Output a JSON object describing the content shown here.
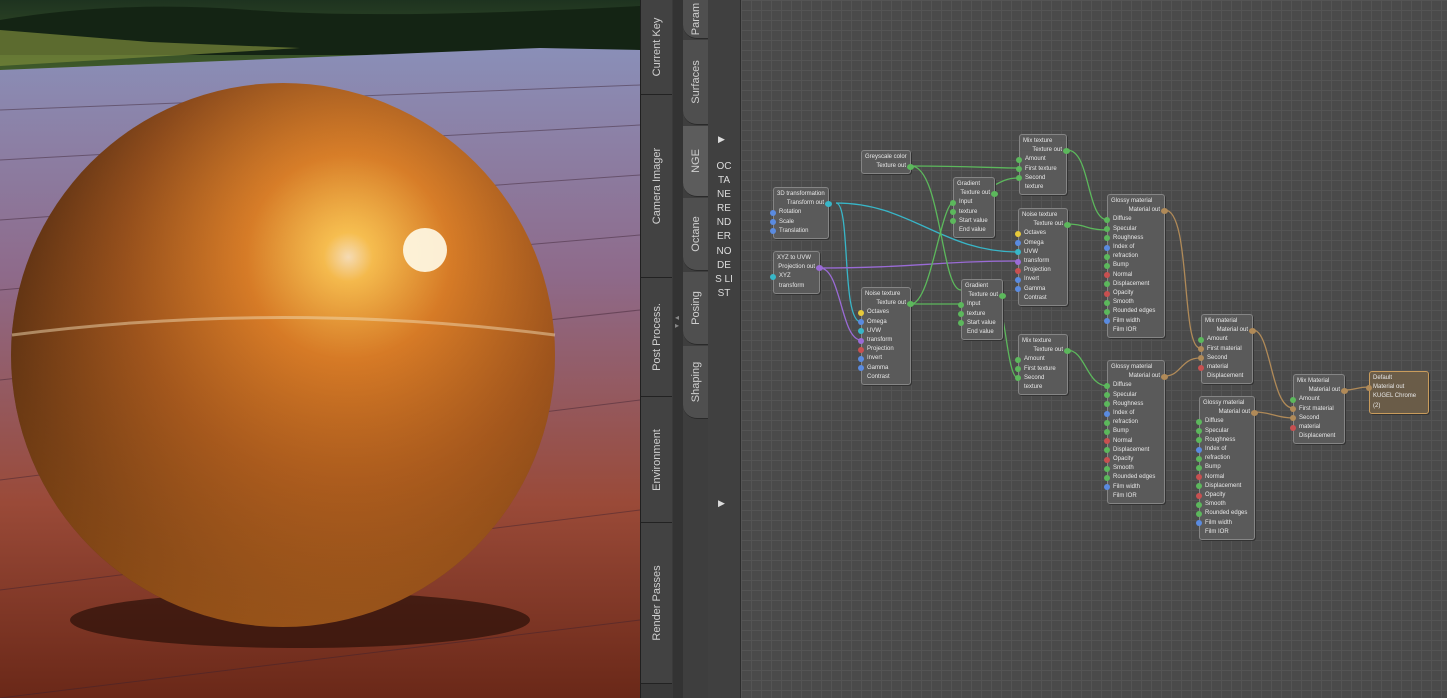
{
  "left_tabs": [
    "Current Key",
    "Camera Imager",
    "Post Process.",
    "Environment",
    "Render Passes"
  ],
  "right_tabs": [
    "Param",
    "Surfaces",
    "NGE",
    "Octane",
    "Posing",
    "Shaping"
  ],
  "nodes_list": {
    "title": "OCTANE RENDER NODES LIST"
  },
  "colors": {
    "texture": "#5cb85c",
    "material": "#b08a58",
    "transform": "#38b6c8",
    "projection": "#9a6bd6",
    "float": "#5a8be0",
    "int": "#e7c93a",
    "bool": "#c85050"
  },
  "nodes": {
    "greyscale": {
      "title": "Greyscale color",
      "out": "Texture out"
    },
    "trans3d": {
      "title": "3D transformation",
      "out": "Transform out",
      "inputs": [
        "Rotation",
        "Scale",
        "Translation"
      ]
    },
    "xyz2uvw": {
      "title": "XYZ to UVW",
      "out": "Projection out",
      "inputs": [
        "XYZ transform"
      ]
    },
    "noise1": {
      "title": "Noise texture",
      "out": "Texture out",
      "inputs": [
        "Octaves",
        "Omega",
        "UVW transform",
        "Projection",
        "Invert",
        "Gamma",
        "Contrast"
      ]
    },
    "gradient1": {
      "title": "Gradient",
      "out": "Texture out",
      "inputs": [
        "Input texture",
        "Start value",
        "End value"
      ]
    },
    "gradient2": {
      "title": "Gradient",
      "out": "Texture out",
      "inputs": [
        "Input texture",
        "Start value",
        "End value"
      ]
    },
    "mix1": {
      "title": "Mix texture",
      "out": "Texture out",
      "inputs": [
        "Amount",
        "First texture",
        "Second texture"
      ]
    },
    "noise2": {
      "title": "Noise texture",
      "out": "Texture out",
      "inputs": [
        "Octaves",
        "Omega",
        "UVW transform",
        "Projection",
        "Invert",
        "Gamma",
        "Contrast"
      ]
    },
    "mix2": {
      "title": "Mix texture",
      "out": "Texture out",
      "inputs": [
        "Amount",
        "First texture",
        "Second texture"
      ]
    },
    "glossy1": {
      "title": "Glossy material",
      "out": "Material out",
      "inputs": [
        "Diffuse",
        "Specular",
        "Roughness",
        "Index of refraction",
        "Bump",
        "Normal",
        "Displacement",
        "Opacity",
        "Smooth",
        "Rounded edges",
        "Film width",
        "Film IOR"
      ]
    },
    "glossy2": {
      "title": "Glossy material",
      "out": "Material out",
      "inputs": [
        "Diffuse",
        "Specular",
        "Roughness",
        "Index of refraction",
        "Bump",
        "Normal",
        "Displacement",
        "Opacity",
        "Smooth",
        "Rounded edges",
        "Film width",
        "Film IOR"
      ]
    },
    "glossy3": {
      "title": "Glossy material",
      "out": "Material out",
      "inputs": [
        "Diffuse",
        "Specular",
        "Roughness",
        "Index of refraction",
        "Bump",
        "Normal",
        "Displacement",
        "Opacity",
        "Smooth",
        "Rounded edges",
        "Film width",
        "Film IOR"
      ]
    },
    "mixmat1": {
      "title": "Mix material",
      "out": "Material out",
      "inputs": [
        "Amount",
        "First material",
        "Second material",
        "Displacement"
      ]
    },
    "mixmat2": {
      "title": "Mix Material",
      "out": "Material out",
      "inputs": [
        "Amount",
        "First material",
        "Second material",
        "Displacement"
      ]
    },
    "default": {
      "title": "Default",
      "sub1": "Material out",
      "sub2": "KUGEL Chrome (2)"
    }
  }
}
